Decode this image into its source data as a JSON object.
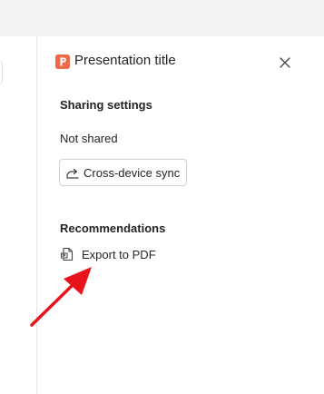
{
  "panel": {
    "title": "Presentation title",
    "app_icon": "powerpoint-icon",
    "close_icon": "close-icon",
    "accent_color": "#ed6c47"
  },
  "sharing": {
    "heading": "Sharing settings",
    "status": "Not shared",
    "sync_button_label": "Cross-device sync",
    "sync_icon": "share-arrow-icon"
  },
  "recommendations": {
    "heading": "Recommendations",
    "items": [
      {
        "label": "Export to PDF",
        "icon": "pdf-export-icon"
      }
    ]
  },
  "annotation": {
    "arrow_color": "#e8141c",
    "arrow_icon": "red-arrow-pointer"
  }
}
